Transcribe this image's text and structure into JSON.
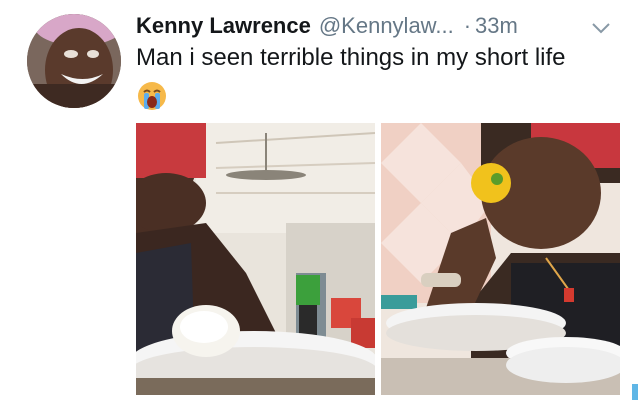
{
  "tweet": {
    "display_name": "Kenny Lawrence",
    "handle": "@Kennylaw...",
    "separator": "·",
    "time": "33m",
    "text": "Man i seen terrible things in my short life"
  },
  "icons": {
    "emoji": "loudly-crying-face",
    "menu": "chevron-down-icon"
  },
  "colors": {
    "text_primary": "#14171a",
    "text_secondary": "#657786"
  }
}
